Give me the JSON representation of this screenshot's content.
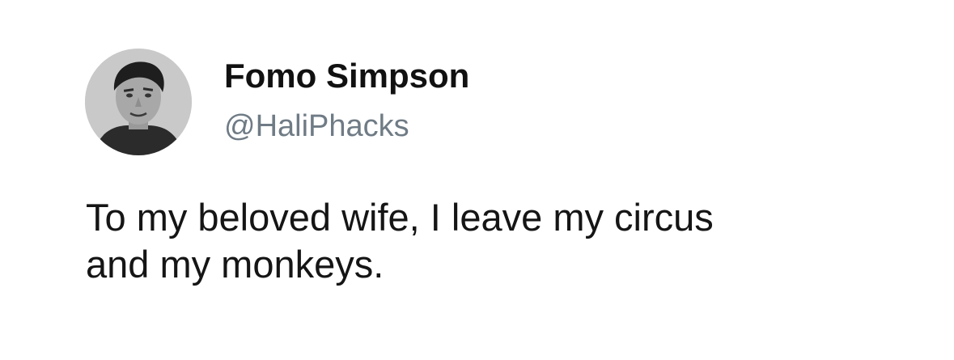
{
  "tweet": {
    "author": {
      "display_name": "Fomo Simpson",
      "handle": "@HaliPhacks",
      "avatar_icon": "profile-photo"
    },
    "text_lines": [
      "To my beloved wife, I leave my circus",
      "and my monkeys."
    ]
  },
  "colors": {
    "background": "#ffffff",
    "name": "#111111",
    "handle": "#6f7b85",
    "text": "#151515"
  }
}
